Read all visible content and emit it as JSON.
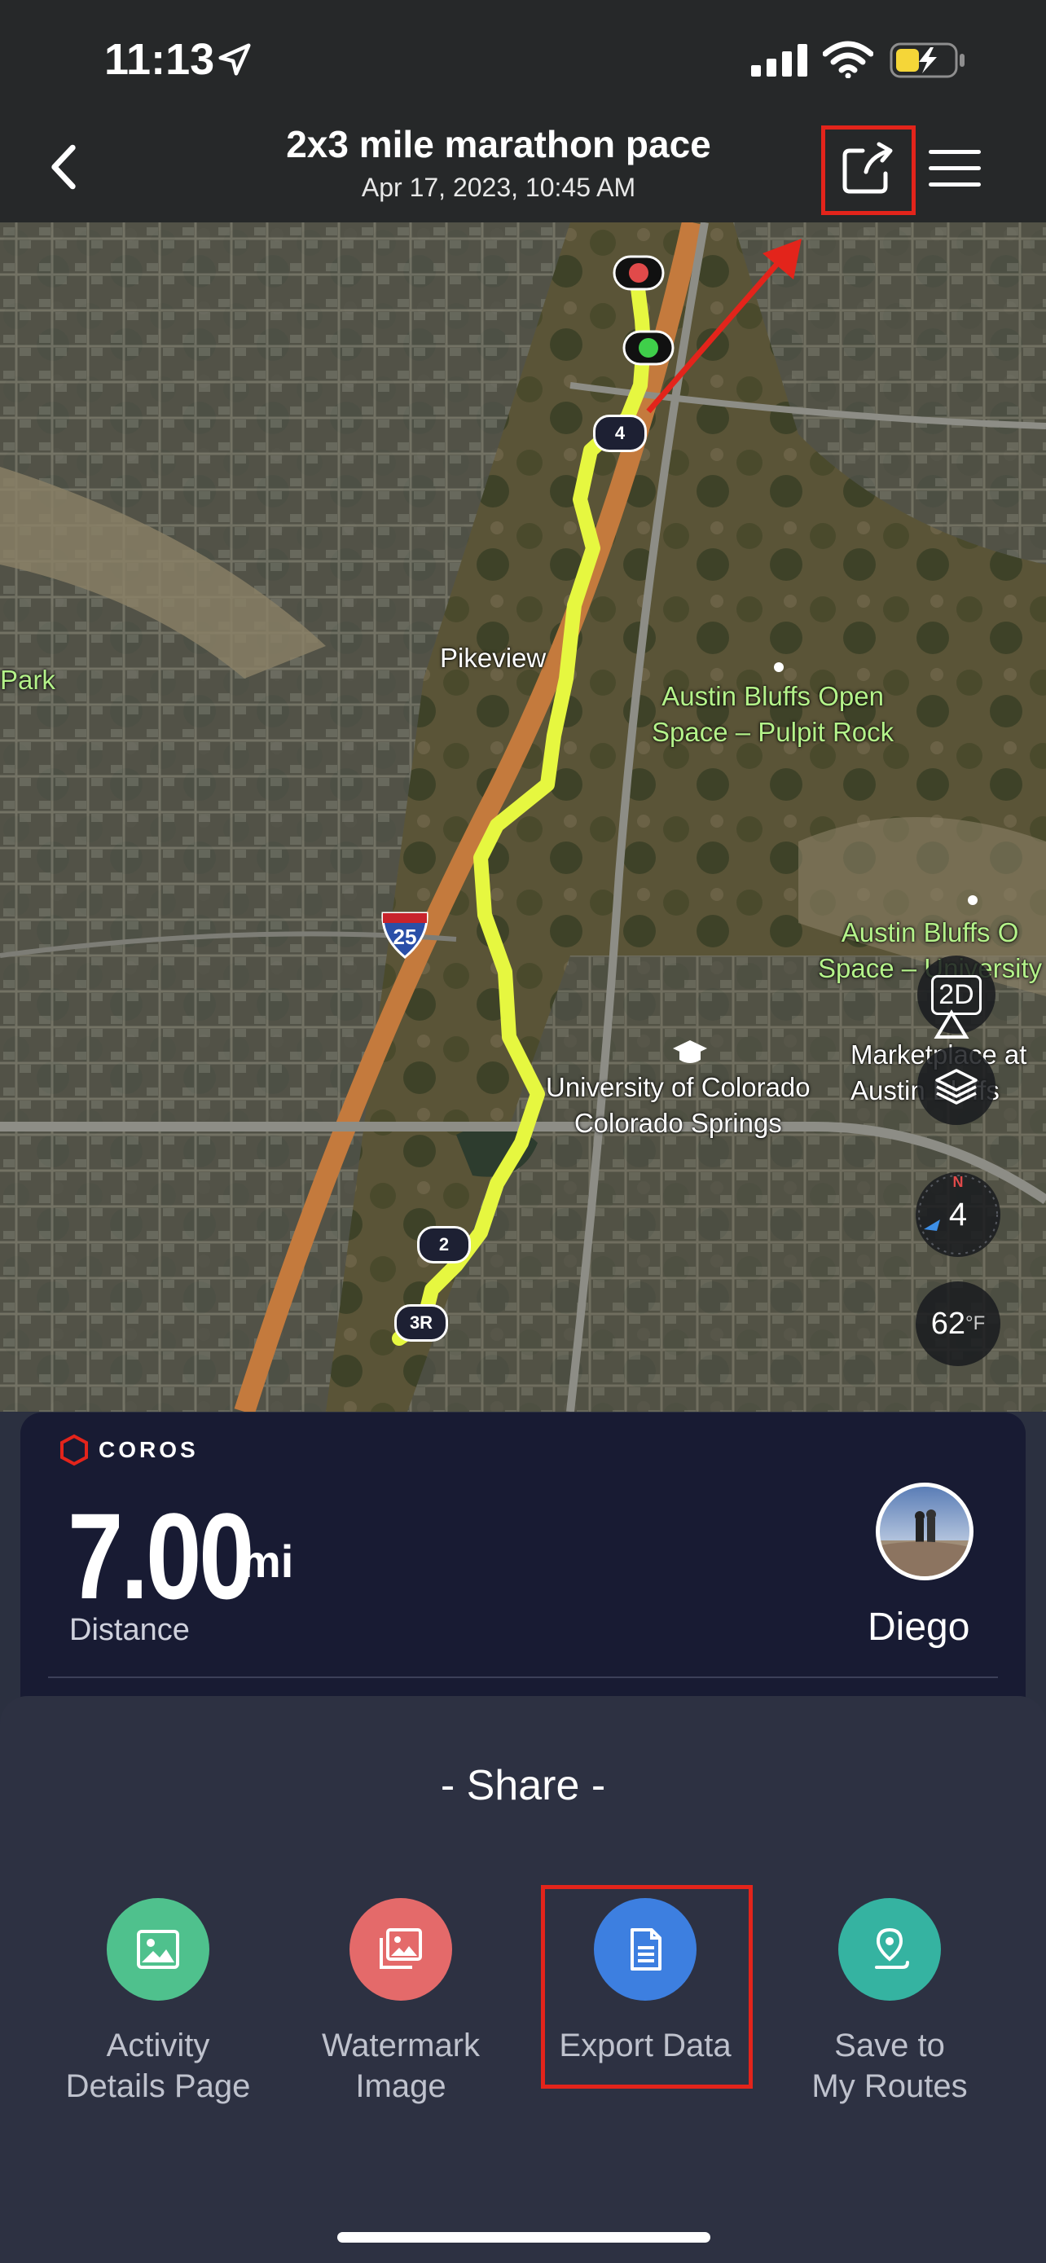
{
  "status_bar": {
    "time": "11:13"
  },
  "header": {
    "title": "2x3 mile marathon pace",
    "subtitle": "Apr 17, 2023, 10:45 AM"
  },
  "map": {
    "labels": {
      "park": "Park",
      "pikeview": "Pikeview",
      "austin_bluffs_1": "Austin Bluffs Open\nSpace – Pulpit Rock",
      "austin_bluffs_2": "Austin Bluffs O\nSpace – University",
      "uccs": "University of Colorado\nColorado Springs",
      "marketplace": "Marketplace at\nAustin Bluffs",
      "highway": "25"
    },
    "markers": [
      "4",
      "2",
      "3R"
    ],
    "controls": {
      "view_mode": "2D",
      "compass_value": "4",
      "compass_north": "N",
      "temperature": "62",
      "temperature_unit": "°F"
    }
  },
  "summary": {
    "brand": "COROS",
    "distance_value": "7.00",
    "distance_unit": "mi",
    "distance_label": "Distance",
    "user_name": "Diego"
  },
  "share_sheet": {
    "title": "- Share -",
    "options": [
      {
        "label": "Activity\nDetails Page",
        "color": "#4fc18d"
      },
      {
        "label": "Watermark\nImage",
        "color": "#e46a6a"
      },
      {
        "label": "Export Data",
        "color": "#3d7fe0"
      },
      {
        "label": "Save to\nMy Routes",
        "color": "#35b3a1"
      }
    ]
  },
  "colors": {
    "route": "#e6f740",
    "highlight": "#e3241b",
    "card_bg": "#181b33",
    "sheet_bg": "#2d3142"
  }
}
